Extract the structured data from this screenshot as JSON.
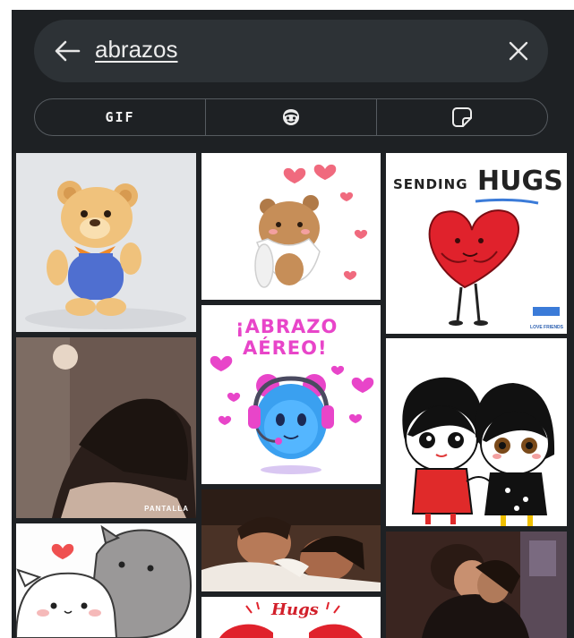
{
  "search": {
    "query": "abrazos",
    "back_icon": "arrow-left-icon",
    "clear_icon": "close-icon"
  },
  "tabs": [
    {
      "label": "GIF",
      "selected": true
    },
    {
      "icon": "emoji-sticker-icon"
    },
    {
      "icon": "sticker-icon"
    }
  ],
  "results": {
    "tiles": [
      {
        "desc": "teddy-bear",
        "text": ""
      },
      {
        "desc": "hugging-bear-hearts",
        "text": ""
      },
      {
        "desc": "sending-hugs-heart",
        "title_small": "SENDING",
        "title_big": "HUGS",
        "brand": "LOVE FRIENDS"
      },
      {
        "desc": "woman-hugging",
        "watermark": "PANTALLA"
      },
      {
        "desc": "abrazo-aereo",
        "line1": "¡ABRAZO",
        "line2": "AÉREO!"
      },
      {
        "desc": "two-girls-hugging",
        "text": ""
      },
      {
        "desc": "cats-hugging",
        "text": ""
      },
      {
        "desc": "couple-sleeping",
        "text": ""
      },
      {
        "desc": "couple-embrace",
        "text": ""
      },
      {
        "desc": "hugs-heart",
        "text": "Hugs"
      }
    ]
  },
  "colors": {
    "panel_bg": "#1e2124",
    "search_bg": "#2d3236",
    "tab_border": "#565b60",
    "accent_blue": "#3b7bd8",
    "heart_red": "#e0222c",
    "pink": "#e845c9"
  }
}
